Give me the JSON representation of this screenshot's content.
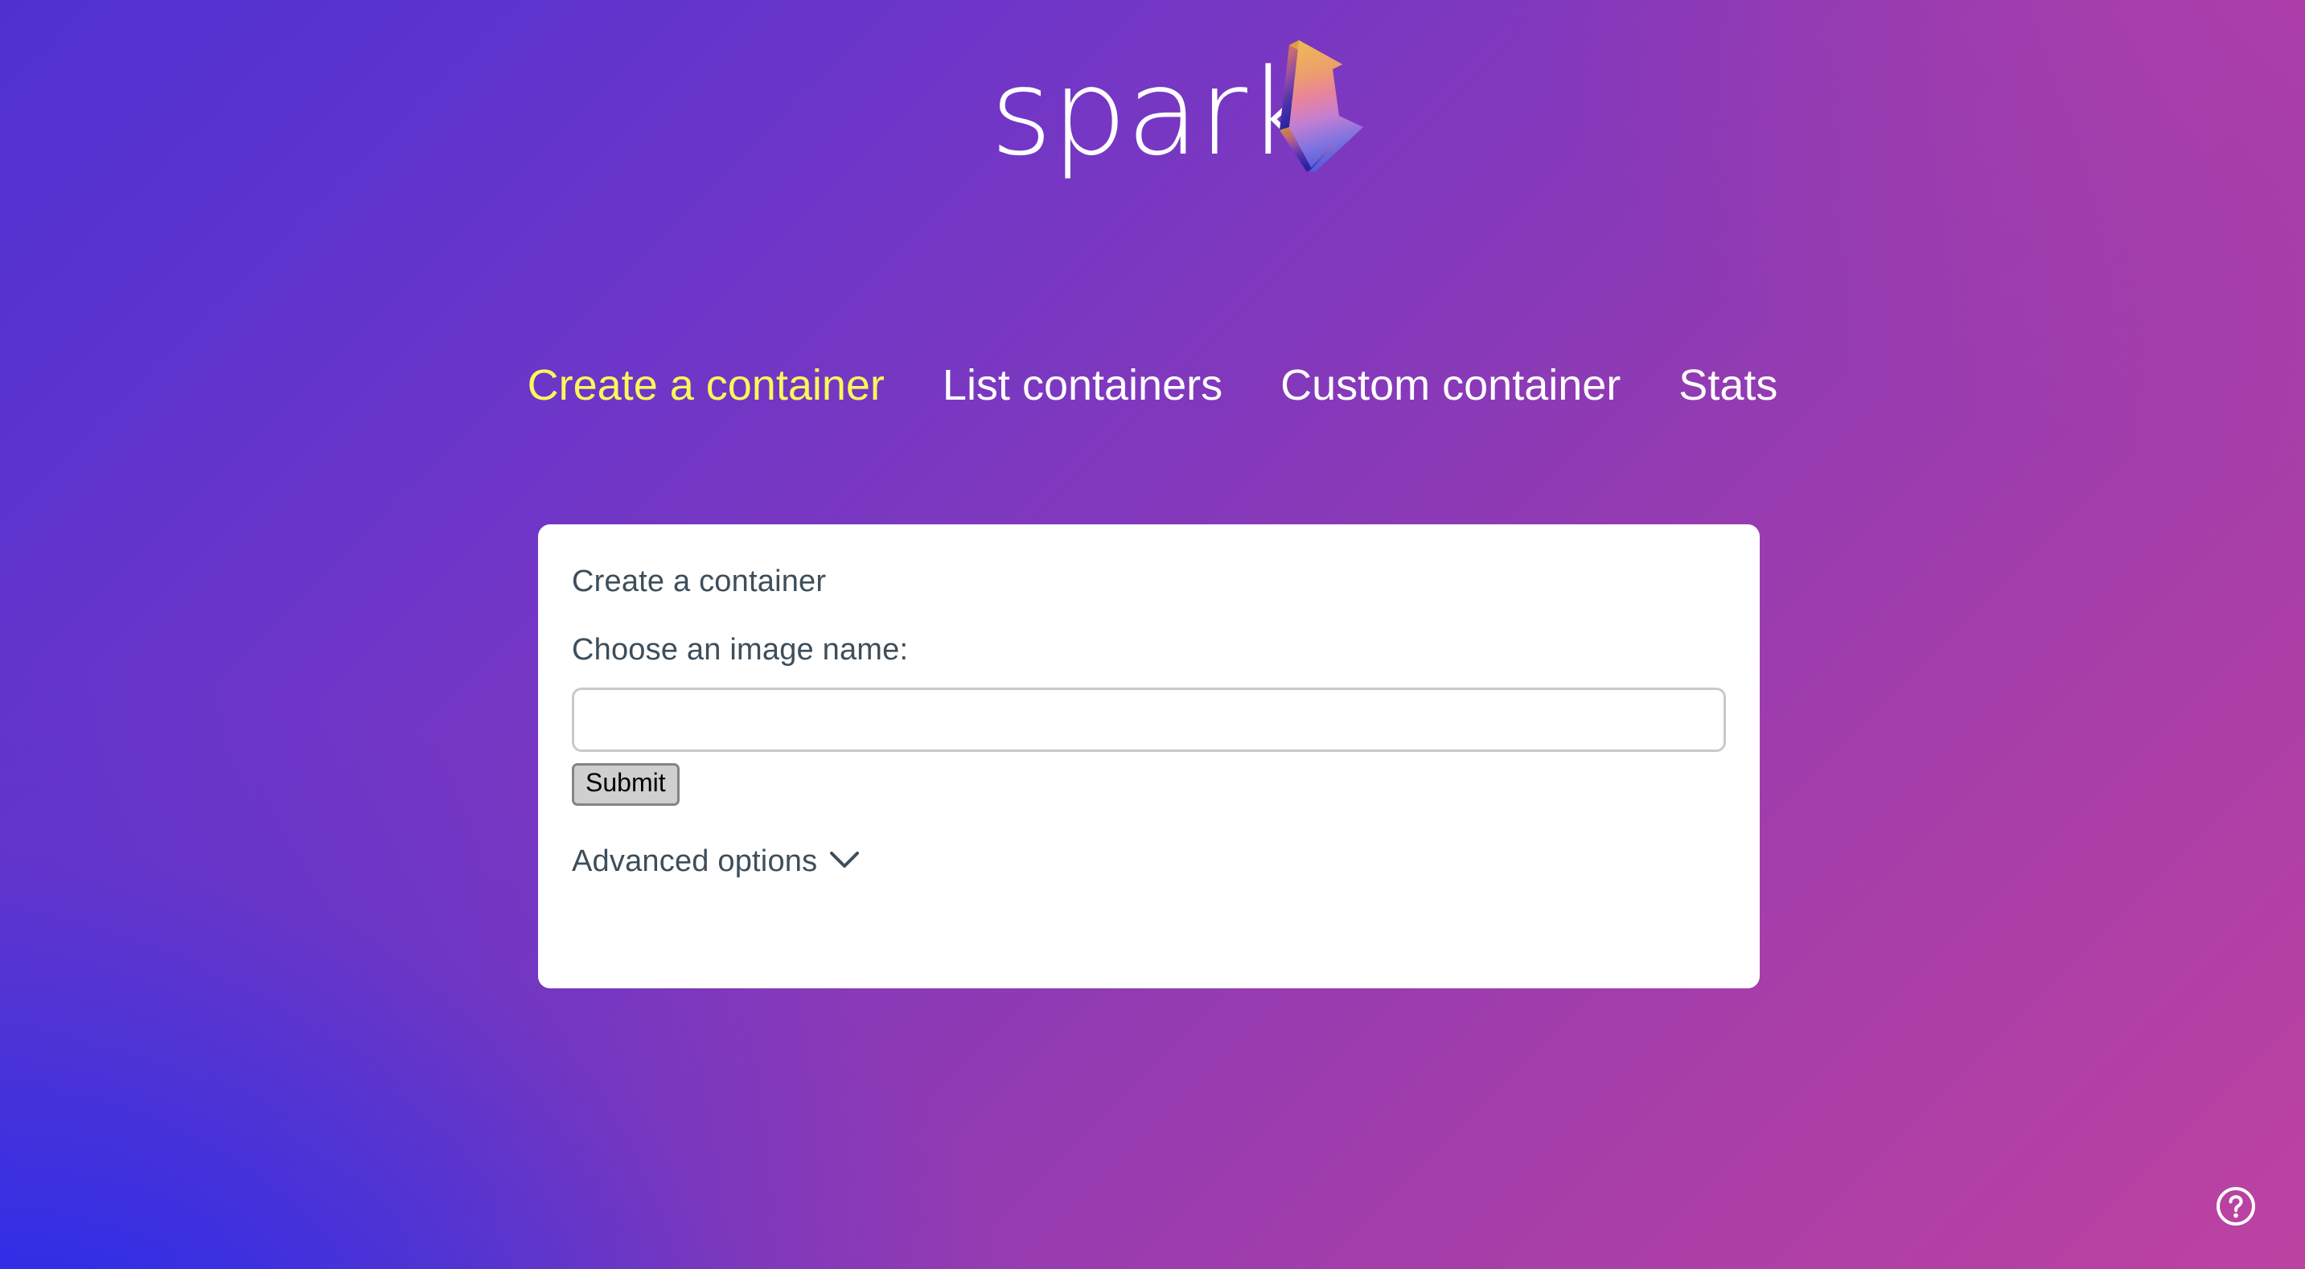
{
  "theme": {
    "bg_gradient_top_left": "#5031d0",
    "bg_gradient_top_right": "#bc42a1",
    "bg_gradient_bottom_left": "#212cee",
    "bg_gradient_bottom_right": "#8a3cc4",
    "accent_active": "#faf85a",
    "text_on_dark": "#ffffff",
    "card_bg": "#ffffff",
    "card_text": "#3e4e5a",
    "input_border": "#c9c9c9",
    "button_bg": "#cfcfcf",
    "button_border": "#848484"
  },
  "logo": {
    "text": "spark",
    "icon": "lightning-bolt-icon",
    "bolt_gradient": [
      "#e8a33d",
      "#e8778f",
      "#b071d8",
      "#4f4fd8",
      "#2a2ab5"
    ]
  },
  "nav": {
    "items": [
      {
        "label": "Create a container",
        "active": true
      },
      {
        "label": "List containers",
        "active": false
      },
      {
        "label": "Custom container",
        "active": false
      },
      {
        "label": "Stats",
        "active": false
      }
    ]
  },
  "card": {
    "title": "Create a container",
    "field": {
      "label": "Choose an image name:",
      "value": "",
      "placeholder": ""
    },
    "submit_label": "Submit",
    "advanced": {
      "label": "Advanced options",
      "icon": "chevron-down-icon",
      "expanded": false
    }
  },
  "help": {
    "icon": "question-circle-icon",
    "label": "?"
  }
}
